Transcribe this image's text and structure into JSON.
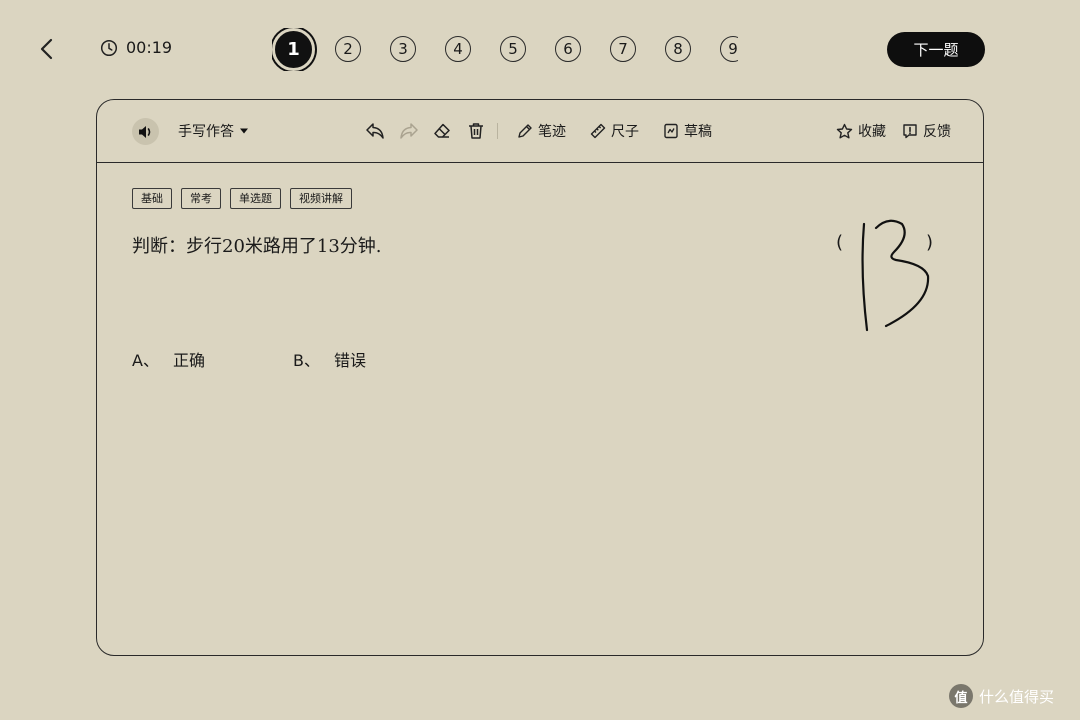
{
  "timer": {
    "value": "00:19"
  },
  "question_nav": {
    "items": [
      "1",
      "2",
      "3",
      "4",
      "5",
      "6",
      "7",
      "8",
      "9"
    ],
    "active_index": 0
  },
  "next_button": {
    "label": "下一题"
  },
  "toolbar": {
    "mode_label": "手写作答",
    "pen_label": "笔迹",
    "ruler_label": "尺子",
    "draft_label": "草稿",
    "favorite_label": "收藏",
    "feedback_label": "反馈"
  },
  "question": {
    "tags": [
      "基础",
      "常考",
      "单选题",
      "视频讲解"
    ],
    "text": "判断：步行20米路用了13分钟.",
    "paren_open": "(",
    "paren_close": ")",
    "handwritten_answer": "13",
    "options": [
      {
        "letter": "A、",
        "text": "正确"
      },
      {
        "letter": "B、",
        "text": "错误"
      }
    ]
  },
  "watermark": {
    "logo_text": "值",
    "text": "什么值得买"
  }
}
